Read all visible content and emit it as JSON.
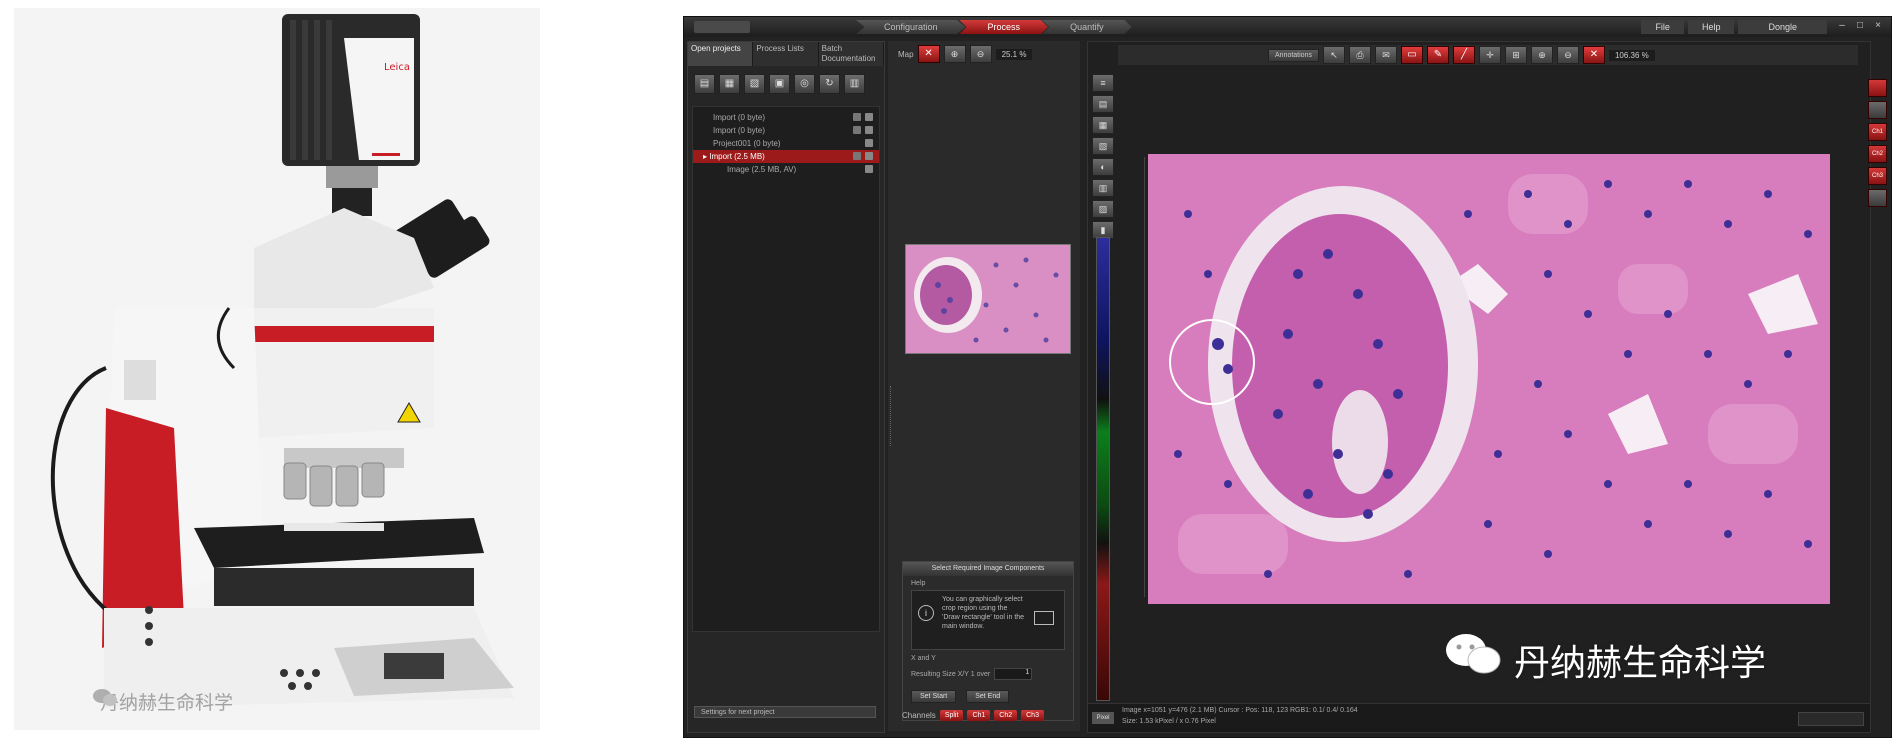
{
  "photo": {
    "watermark_text": "丹纳赫生命科学"
  },
  "app": {
    "workflow_tabs": [
      "Configuration",
      "Process",
      "Quantify"
    ],
    "active_workflow": "Process",
    "menu": [
      "File",
      "Help",
      "Dongle"
    ],
    "project_panel": {
      "tabs": [
        "Open projects",
        "Process Lists",
        "Batch Documentation"
      ],
      "tree": [
        {
          "label": "Import    (0 byte)",
          "state": "normal"
        },
        {
          "label": "Import    (0 byte)",
          "state": "normal"
        },
        {
          "label": "Project001    (0 byte)",
          "state": "normal"
        },
        {
          "label": "Import    (2.5 MB)",
          "state": "selected"
        },
        {
          "label": "Image    (2.5 MB, AV)",
          "state": "child"
        }
      ],
      "settings_label": "Settings for next project"
    },
    "map": {
      "label": "Map",
      "zoom": "25.1 %"
    },
    "select_panel": {
      "title": "Select Required Image Components",
      "help_label": "Help",
      "help_text": "You can graphically select crop region using the 'Draw rectangle' tool in the main window.",
      "xy_label": "X and Y",
      "resulting_size_label": "Resulting Size  X/Y  1 over",
      "resulting_size_value": "1",
      "btn_left": "Set Start",
      "btn_right": "Set End"
    },
    "channels": {
      "label": "Channels",
      "items": [
        "Split",
        "Ch1",
        "Ch2",
        "Ch3"
      ]
    },
    "viewer": {
      "annotations_label": "Annotations",
      "zoom": "106.36 %",
      "status_button": "Pixel",
      "status_line1": "Image x=1051 y=476 (2.1 MB)     Cursor : Pos: 118, 123     RGB1: 0.1/ 0.4/ 0.164",
      "status_line2": "Size: 1.53 kPixel / x 0.76 Pixel"
    },
    "right_strip": [
      "",
      "",
      "Ch1",
      "Ch2",
      "Ch3",
      ""
    ],
    "watermark_text": "丹纳赫生命科学"
  }
}
